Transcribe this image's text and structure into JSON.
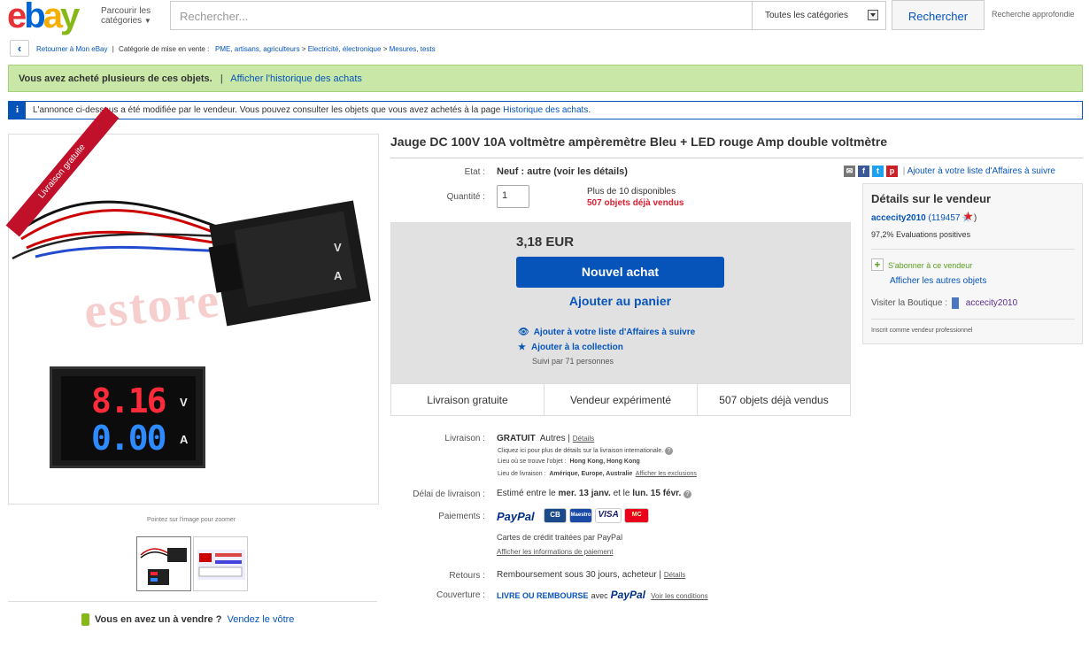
{
  "header": {
    "logo_letters": [
      "e",
      "b",
      "a",
      "y"
    ],
    "browse_label": "Parcourir les catégories",
    "search_placeholder": "Rechercher...",
    "category_select": "Toutes les catégories",
    "search_button": "Rechercher",
    "advanced_search": "Recherche approfondie"
  },
  "breadcrumb": {
    "back_label": "Retourner à Mon eBay",
    "category_prefix": "Catégorie de mise en vente :",
    "items": [
      "PME, artisans, agriculteurs",
      "Electricité, électronique",
      "Mesures, tests"
    ]
  },
  "notice_green": {
    "text": "Vous avez acheté plusieurs de ces objets.",
    "sep": "|",
    "link": "Afficher l'historique des achats"
  },
  "notice_info": {
    "icon": "i",
    "text": "L'annonce ci-dessous a été modifiée par le vendeur. Vous pouvez consulter les objets que vous avez achetés à la page",
    "link": "Historique des achats",
    "end": "."
  },
  "gallery": {
    "ribbon": "Livraison gratuite",
    "watermark": "estore",
    "meter_top": "8.16",
    "meter_bottom": "0.00",
    "unit_v": "V",
    "unit_a": "A",
    "zoom_hint": "Pointez sur l'image pour zoomer"
  },
  "sell": {
    "question": "Vous en avez un à vendre ?",
    "link": "Vendez le vôtre"
  },
  "listing": {
    "title": "Jauge DC 100V 10A voltmètre ampèremètre Bleu + LED rouge Amp double voltmètre",
    "etat_label": "Etat :",
    "etat_value": "Neuf : autre",
    "etat_detail": "(voir les détails)",
    "qty_label": "Quantité :",
    "qty_value": "1",
    "available": "Plus de 10 disponibles",
    "sold": "507 objets déjà vendus",
    "price": "3,18 EUR",
    "buy_now": "Nouvel achat",
    "add_cart": "Ajouter au panier",
    "watch": "Ajouter à votre liste d'Affaires à suivre",
    "collection": "Ajouter à la collection",
    "followers": "Suivi par 71 personnes",
    "badges": [
      "Livraison gratuite",
      "Vendeur expérimenté",
      "507 objets déjà vendus"
    ]
  },
  "shipping": {
    "label": "Livraison :",
    "free": "GRATUIT",
    "type": "Autres |",
    "details": "Détails",
    "intl": "Cliquez ici pour plus de détails sur la livraison internationale.",
    "location_label": "Lieu où se trouve l'objet :",
    "location": "Hong Kong, Hong Kong",
    "ship_to_label": "Lieu de livraison :",
    "ship_to": "Amérique, Europe, Australie",
    "exclusions": "Afficher les exclusions",
    "delay_label": "Délai de livraison :",
    "delay_pre": "Estimé entre le",
    "delay_from": "mer. 13 janv.",
    "delay_mid": "et le",
    "delay_to": "lun. 15 févr.",
    "pay_label": "Paiements :",
    "paypal": "PayPal",
    "cards": [
      "CB",
      "Maestro",
      "VISA",
      "MC"
    ],
    "pay_note": "Cartes de crédit traitées par PayPal",
    "pay_info": "Afficher les informations de paiement",
    "returns_label": "Retours :",
    "returns": "Remboursement sous 30 jours, acheteur |",
    "returns_details": "Détails",
    "coverage_label": "Couverture :",
    "coverage": "LIVRE OU REMBOURSE",
    "coverage_with": "avec",
    "coverage_link": "Voir les conditions"
  },
  "share": {
    "watch_link": "Ajouter à votre liste d'Affaires à suivre"
  },
  "seller": {
    "heading": "Détails sur le vendeur",
    "name": "accecity2010",
    "score": "(119457",
    "score_end": ")",
    "positive": "97,2% Evaluations positives",
    "subscribe": "S'abonner à ce vendeur",
    "other_items": "Afficher les autres objets",
    "store_label": "Visiter la Boutique :",
    "store": "accecity2010",
    "pro": "Inscrit comme vendeur professionnel"
  },
  "colors": {
    "ebay_red": "#e53238",
    "ebay_blue": "#0064d2",
    "ebay_yellow": "#f5af02",
    "ebay_green": "#86b817",
    "link": "#0654ba",
    "sold_red": "#dd1e31"
  }
}
